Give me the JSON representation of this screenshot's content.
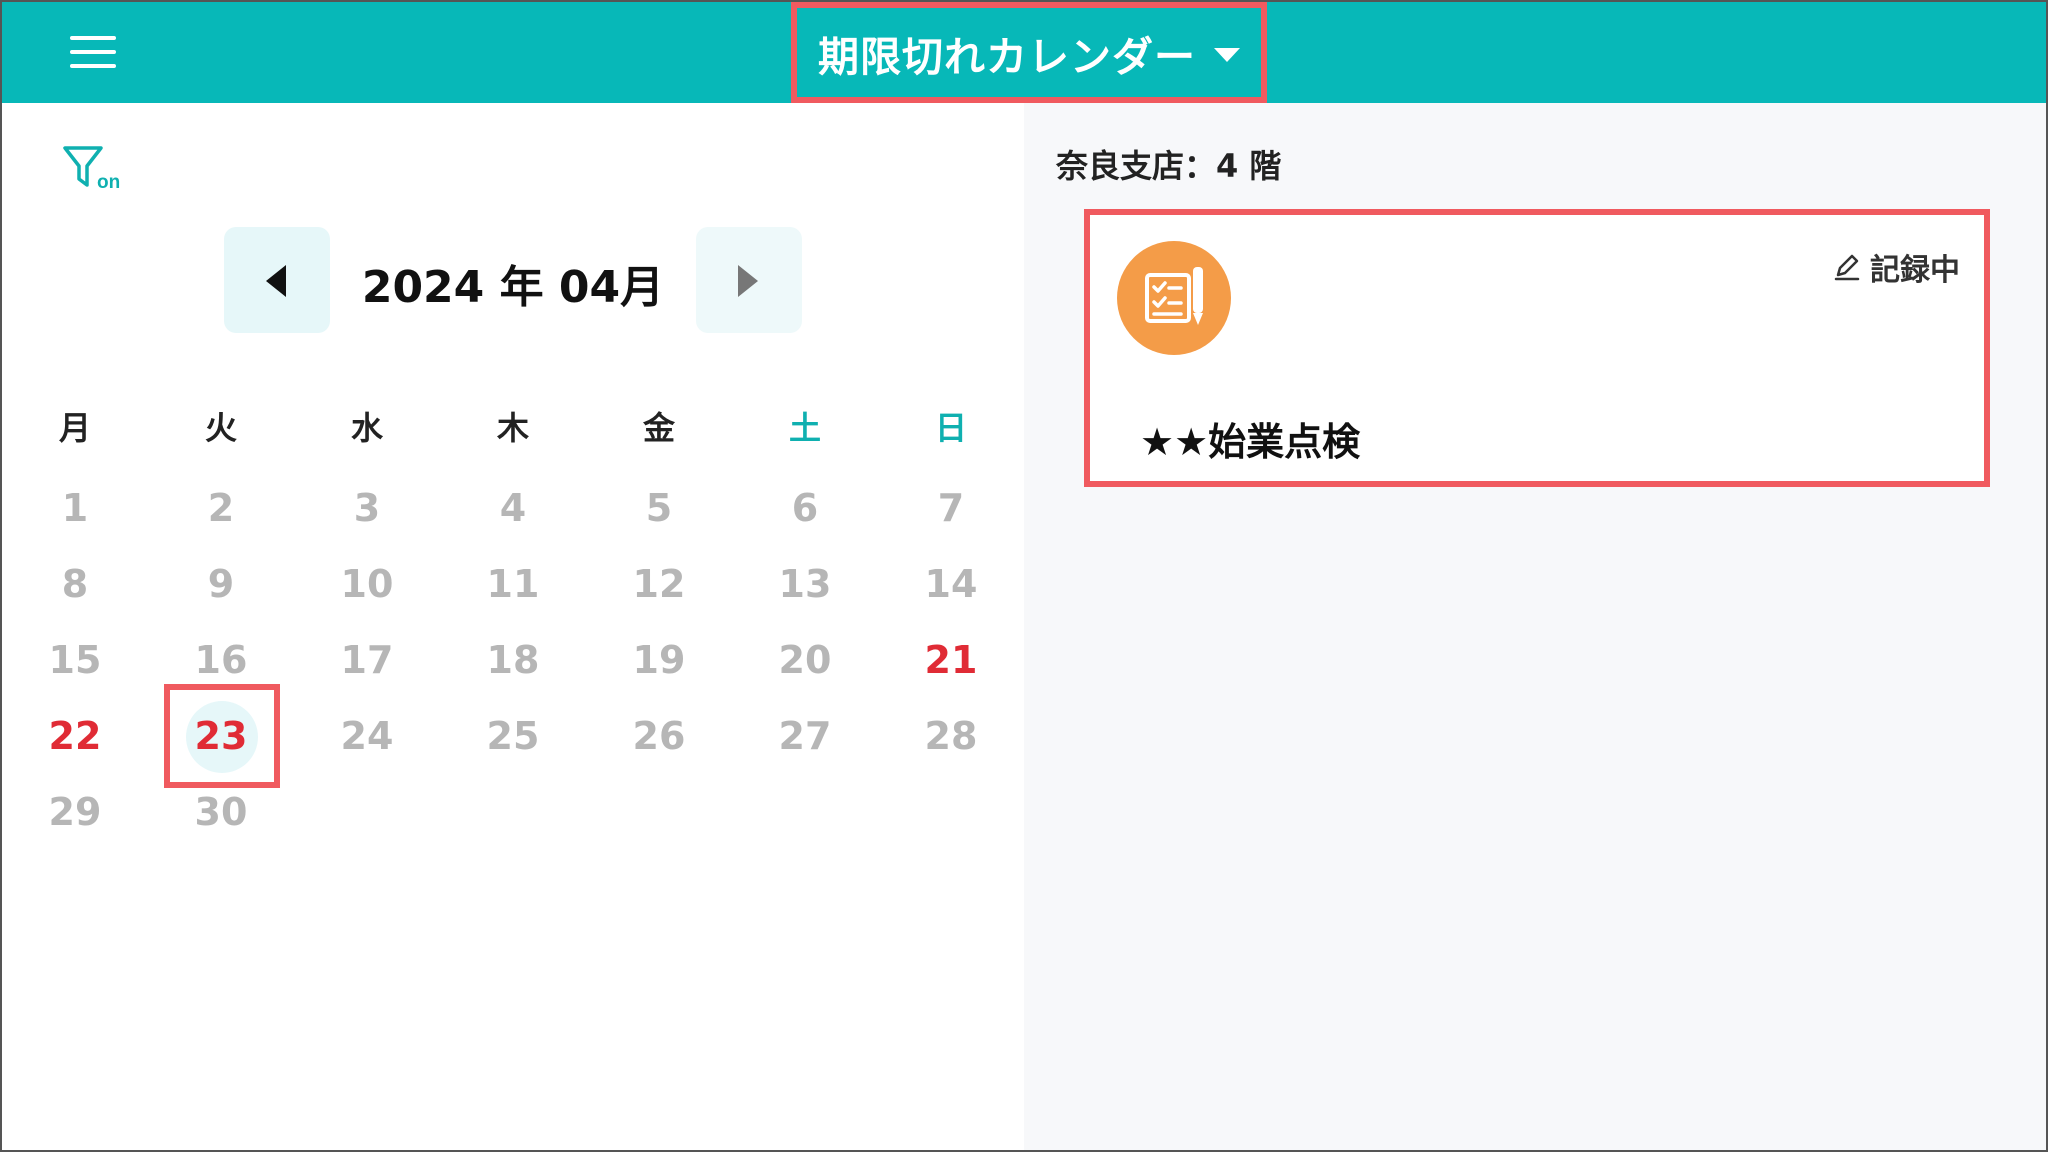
{
  "header": {
    "title": "期限切れカレンダー",
    "menu_icon": "hamburger-menu-icon",
    "dropdown_icon": "caret-down-icon",
    "bg_color": "#07b8b8"
  },
  "filter": {
    "icon": "filter-icon",
    "label": "on"
  },
  "calendar": {
    "month_label": "2024 年 04月",
    "prev_icon": "chevron-left-icon",
    "next_icon": "chevron-right-icon",
    "weekdays": [
      "月",
      "火",
      "水",
      "木",
      "金",
      "土",
      "日"
    ],
    "days": [
      "1",
      "2",
      "3",
      "4",
      "5",
      "6",
      "7",
      "8",
      "9",
      "10",
      "11",
      "12",
      "13",
      "14",
      "15",
      "16",
      "17",
      "18",
      "19",
      "20",
      "21",
      "22",
      "23",
      "24",
      "25",
      "26",
      "27",
      "28",
      "29",
      "30"
    ],
    "highlighted_days": [
      "21",
      "22",
      "23"
    ],
    "selected_day": "23",
    "weekend_color": "#0fb0b0",
    "highlight_color": "#e02b35"
  },
  "right_panel": {
    "location": "奈良支店：4 階",
    "card": {
      "icon": "checklist-icon",
      "status_icon": "pencil-icon",
      "status": "記録中",
      "title": "★★始業点検",
      "icon_color": "#f49c48"
    }
  }
}
